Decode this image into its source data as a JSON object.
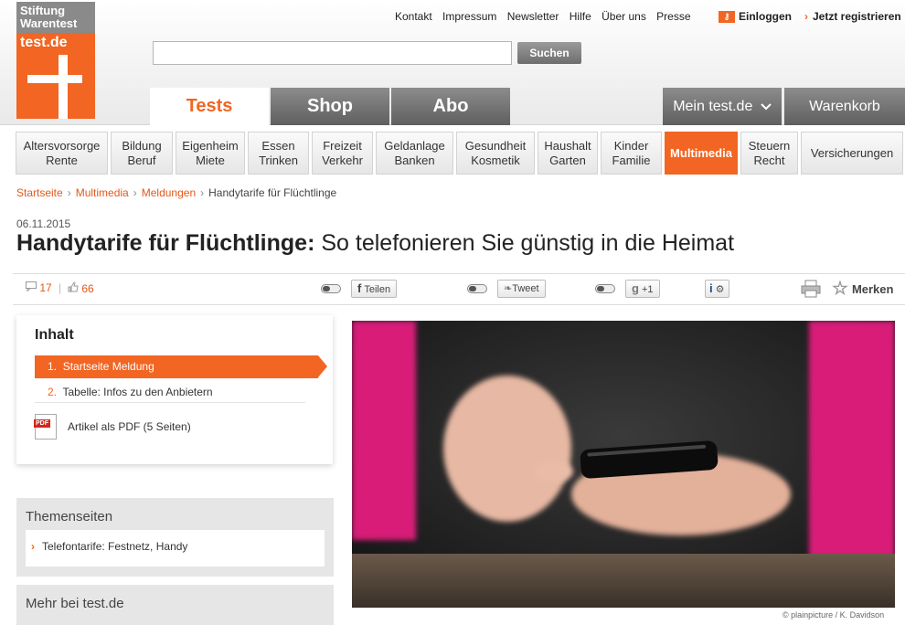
{
  "logo": {
    "line1": "Stiftung",
    "line2": "Warentest",
    "domain": "test.de"
  },
  "toplinks": [
    "Kontakt",
    "Impressum",
    "Newsletter",
    "Hilfe",
    "Über uns",
    "Presse"
  ],
  "login": {
    "label": "Einloggen",
    "icon": "key-icon"
  },
  "register": {
    "label": "Jetzt registrieren"
  },
  "search": {
    "value": "",
    "placeholder": "",
    "button": "Suchen"
  },
  "main_tabs": {
    "tests": "Tests",
    "shop": "Shop",
    "abo": "Abo",
    "mein": "Mein test.de",
    "warenkorb": "Warenkorb"
  },
  "categories": [
    {
      "l1": "Altersvorsorge",
      "l2": "Rente"
    },
    {
      "l1": "Bildung",
      "l2": "Beruf"
    },
    {
      "l1": "Eigenheim",
      "l2": "Miete"
    },
    {
      "l1": "Essen",
      "l2": "Trinken"
    },
    {
      "l1": "Freizeit",
      "l2": "Verkehr"
    },
    {
      "l1": "Geldanlage",
      "l2": "Banken"
    },
    {
      "l1": "Gesundheit",
      "l2": "Kosmetik"
    },
    {
      "l1": "Haushalt",
      "l2": "Garten"
    },
    {
      "l1": "Kinder",
      "l2": "Familie"
    },
    {
      "l1": "Multimedia",
      "l2": ""
    },
    {
      "l1": "Steuern",
      "l2": "Recht"
    },
    {
      "l1": "Versicherungen",
      "l2": ""
    }
  ],
  "breadcrumb": [
    "Startseite",
    "Multimedia",
    "Meldungen",
    "Handytarife für Flüchtlinge"
  ],
  "article": {
    "date": "06.11.2015",
    "title_bold": "Handytarife für Flüchtlinge:",
    "title_rest": "So telefonieren Sie günstig in die Heimat"
  },
  "social": {
    "comments": "17",
    "likes": "66",
    "share": "Teilen",
    "tweet": "Tweet",
    "gplus": "+1",
    "merken": "Merken"
  },
  "inhalt": {
    "title": "Inhalt",
    "items": [
      {
        "num": "1.",
        "label": "Startseite Meldung"
      },
      {
        "num": "2.",
        "label": "Tabelle: Infos zu den Anbietern"
      }
    ],
    "pdf_label": "Artikel als PDF (5 Seiten)"
  },
  "themenseiten": {
    "title": "Themenseiten",
    "link": "Telefontarife: Festnetz, Handy"
  },
  "mehr": {
    "title": "Mehr bei test.de"
  },
  "photo": {
    "credit": "© plainpicture / K. Davidson"
  },
  "colors": {
    "accent": "#f26522",
    "tab_grey": "#6e6e6e"
  }
}
